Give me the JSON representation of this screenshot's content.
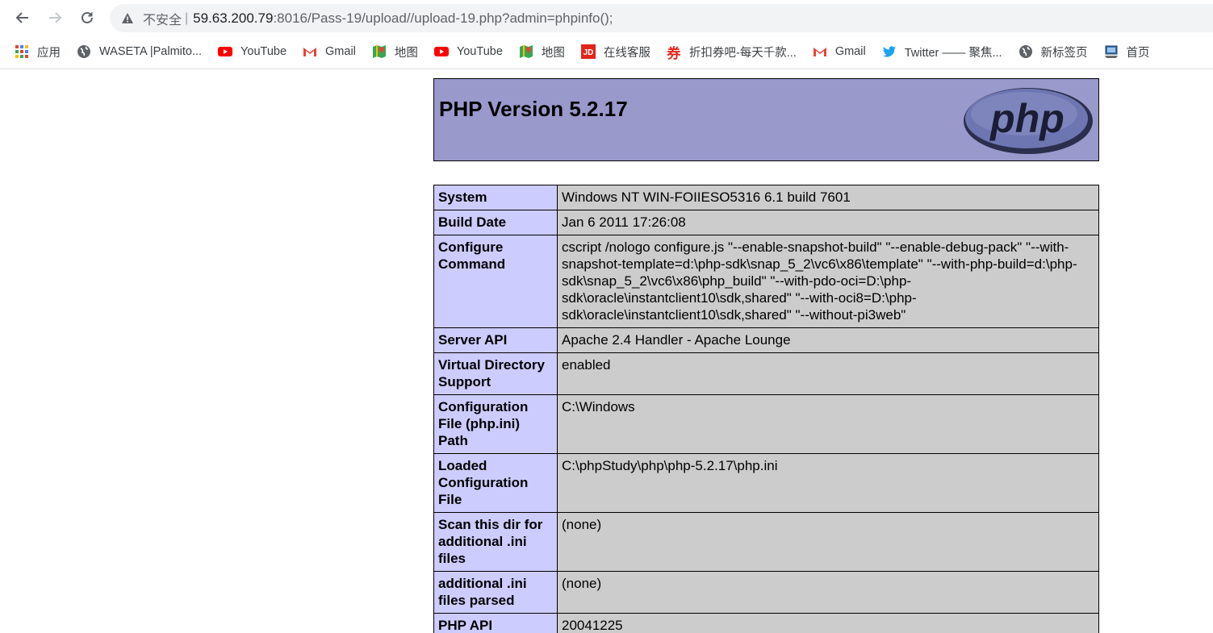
{
  "browser": {
    "address": {
      "security_label": "不安全",
      "separator": "|",
      "url_host": "59.63.200.79",
      "url_rest": ":8016/Pass-19/upload//upload-19.php?admin=phpinfo();"
    },
    "nav_icons": [
      "back-arrow-icon",
      "forward-arrow-icon",
      "reload-icon"
    ],
    "bookmarks": [
      {
        "label": "应用",
        "icon": "apps-grid-icon"
      },
      {
        "label": "WASETA |Palmito...",
        "icon": "globe-icon"
      },
      {
        "label": "YouTube",
        "icon": "youtube-icon"
      },
      {
        "label": "Gmail",
        "icon": "gmail-icon"
      },
      {
        "label": "地图",
        "icon": "maps-icon"
      },
      {
        "label": "YouTube",
        "icon": "youtube-icon"
      },
      {
        "label": "地图",
        "icon": "maps-icon"
      },
      {
        "label": "在线客服",
        "icon": "jd-icon"
      },
      {
        "label": "折扣券吧-每天千款...",
        "icon": "coupon-icon"
      },
      {
        "label": "Gmail",
        "icon": "gmail-icon"
      },
      {
        "label": "Twitter —— 聚焦...",
        "icon": "twitter-icon"
      },
      {
        "label": "新标签页",
        "icon": "globe-icon"
      },
      {
        "label": "首页",
        "icon": "computer-icon"
      }
    ]
  },
  "phpinfo": {
    "title": "PHP Version 5.2.17",
    "logo_text": "php",
    "colors": {
      "header": "#9999cc",
      "key_cell": "#ccccff",
      "value_cell": "#cccccc"
    },
    "rows": [
      {
        "key": "System",
        "value": "Windows NT WIN-FOIIESO5316 6.1 build 7601"
      },
      {
        "key": "Build Date",
        "value": "Jan 6 2011 17:26:08"
      },
      {
        "key": "Configure Command",
        "value": "cscript /nologo configure.js \"--enable-snapshot-build\" \"--enable-debug-pack\" \"--with-snapshot-template=d:\\php-sdk\\snap_5_2\\vc6\\x86\\template\" \"--with-php-build=d:\\php-sdk\\snap_5_2\\vc6\\x86\\php_build\" \"--with-pdo-oci=D:\\php-sdk\\oracle\\instantclient10\\sdk,shared\" \"--with-oci8=D:\\php-sdk\\oracle\\instantclient10\\sdk,shared\" \"--without-pi3web\""
      },
      {
        "key": "Server API",
        "value": "Apache 2.4 Handler - Apache Lounge"
      },
      {
        "key": "Virtual Directory Support",
        "value": "enabled"
      },
      {
        "key": "Configuration File (php.ini) Path",
        "value": "C:\\Windows"
      },
      {
        "key": "Loaded Configuration File",
        "value": "C:\\phpStudy\\php\\php-5.2.17\\php.ini"
      },
      {
        "key": "Scan this dir for additional .ini files",
        "value": "(none)"
      },
      {
        "key": "additional .ini files parsed",
        "value": "(none)"
      },
      {
        "key": "PHP API",
        "value": "20041225"
      }
    ]
  }
}
